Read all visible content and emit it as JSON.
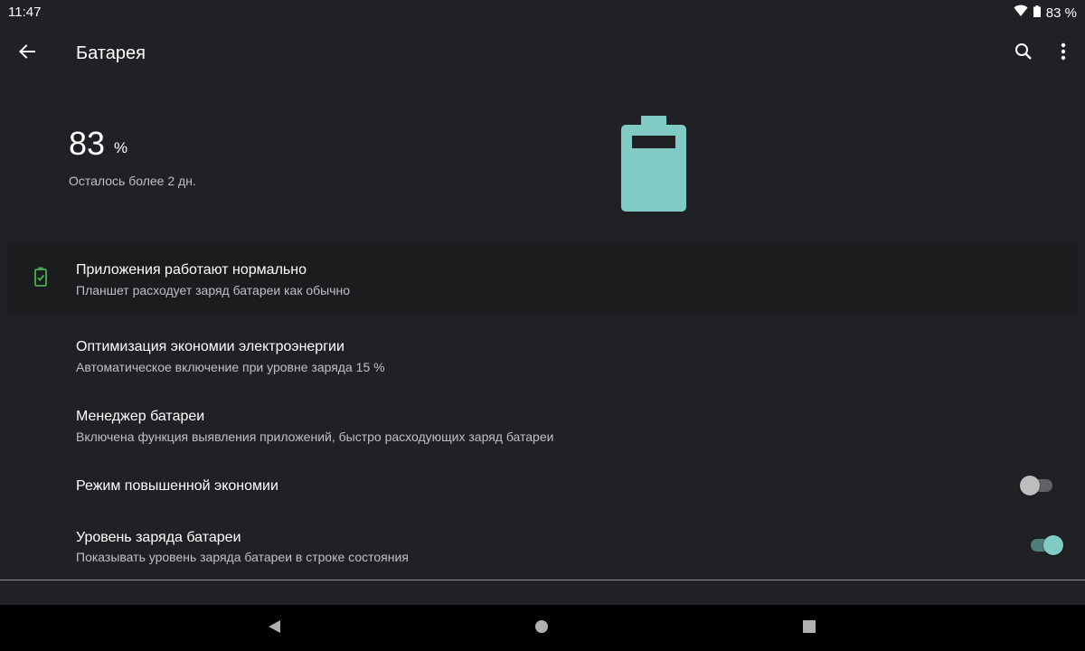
{
  "status": {
    "time": "11:47",
    "battery_text": "83 %"
  },
  "header": {
    "title": "Батарея"
  },
  "battery": {
    "percent_value": "83",
    "percent_unit": "%",
    "remaining_text": "Осталось более 2 дн.",
    "level": 0.83,
    "color": "#80cbc4"
  },
  "tip": {
    "title": "Приложения работают нормально",
    "subtitle": "Планшет расходует заряд батареи как обычно",
    "icon": "battery-check-icon",
    "icon_color": "#4caf50"
  },
  "settings": [
    {
      "title": "Оптимизация экономии электроэнергии",
      "subtitle": "Автоматическое включение при уровне заряда 15 %"
    },
    {
      "title": "Менеджер батареи",
      "subtitle": "Включена функция выявления приложений, быстро расходующих заряд батареи"
    },
    {
      "title": "Режим повышенной экономии",
      "subtitle": "",
      "toggle": false
    },
    {
      "title": "Уровень заряда батареи",
      "subtitle": "Показывать уровень заряда батареи в строке состояния",
      "toggle": true
    }
  ],
  "colors": {
    "background": "#202124",
    "accent": "#80cbc4",
    "nav_bar": "#000000"
  },
  "nav": {
    "back": "back-triangle-icon",
    "home": "home-circle-icon",
    "recents": "recents-square-icon"
  }
}
